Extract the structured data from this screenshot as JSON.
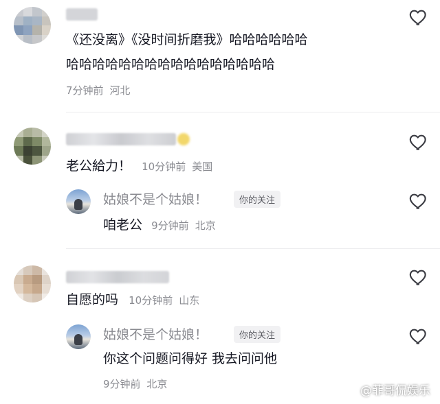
{
  "comments": [
    {
      "text_line1": "《还没离》《没时间折磨我》哈哈哈哈哈哈",
      "text_line2": "哈哈哈哈哈哈哈哈哈哈哈哈哈哈哈哈",
      "time": "7分钟前",
      "location": "河北"
    },
    {
      "text": "老公給力！",
      "time": "10分钟前",
      "location": "美国",
      "reply": {
        "name": "姑娘不是个姑娘！",
        "badge": "你的关注",
        "text": "咱老公",
        "time": "9分钟前",
        "location": "北京"
      }
    },
    {
      "text": "自愿的吗",
      "time": "10分钟前",
      "location": "山东",
      "reply": {
        "name": "姑娘不是个姑娘！",
        "badge": "你的关注",
        "text": "你这个问题问得好 我去问问他",
        "time": "9分钟前",
        "location": "北京"
      }
    }
  ],
  "icons": {
    "like": "heart-outline-icon"
  },
  "watermark": "@菲哥侃娱乐",
  "colors": {
    "text": "#161823",
    "meta": "#8a8b91",
    "badge_bg": "#f1f1f3"
  }
}
